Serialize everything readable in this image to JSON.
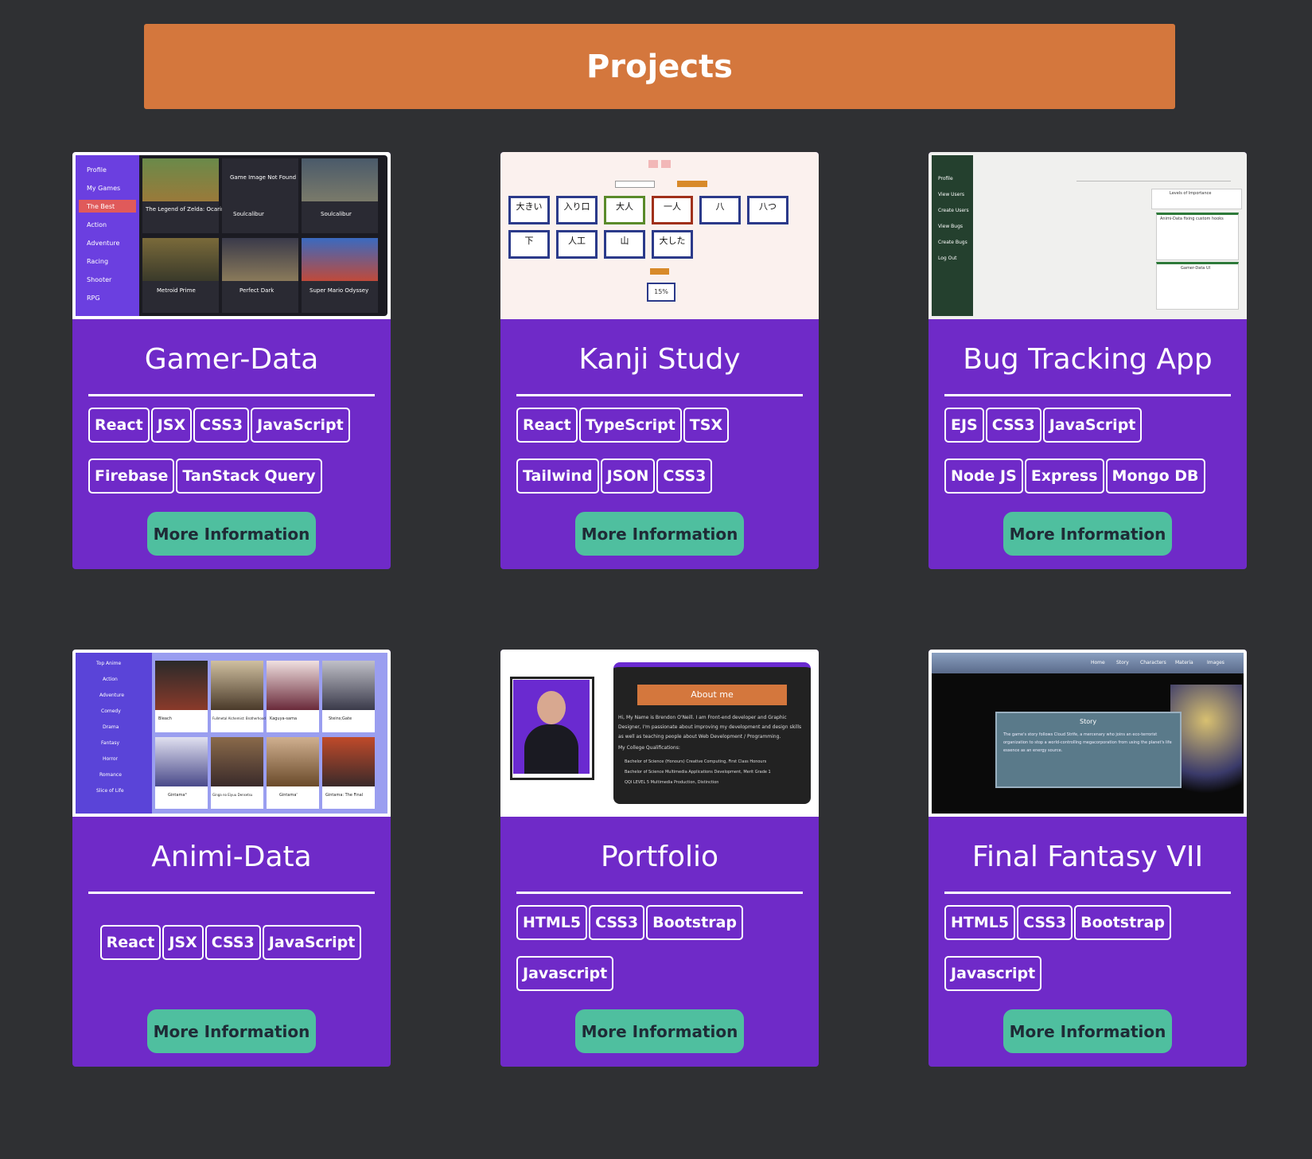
{
  "header": {
    "title": "Projects"
  },
  "projects": [
    {
      "title": "Gamer-Data",
      "tags": [
        "React",
        "JSX",
        "CSS3",
        "JavaScript",
        "Firebase",
        "TanStack Query"
      ],
      "button": "More Information",
      "thumb": {
        "menu": [
          "Profile",
          "My Games",
          "The Best",
          "Action",
          "Adventure",
          "Racing",
          "Shooter",
          "RPG"
        ],
        "games": [
          "The Legend of Zelda: Ocarina of Time",
          "Soulcalibur",
          "Soulcalibur",
          "Metroid Prime",
          "Perfect Dark",
          "Super Mario Odyssey"
        ],
        "not_found": "Game Image Not Found"
      }
    },
    {
      "title": "Kanji Study",
      "tags": [
        "React",
        "TypeScript",
        "TSX",
        "Tailwind",
        "JSON",
        "CSS3"
      ],
      "button": "More Information",
      "thumb": {
        "kanji_row1": [
          "大きい",
          "入り口",
          "大人",
          "一人",
          "八",
          "八つ"
        ],
        "kanji_row2": [
          "下",
          "人工",
          "山",
          "大した"
        ],
        "score": "15%"
      }
    },
    {
      "title": "Bug Tracking App",
      "tags": [
        "EJS",
        "CSS3",
        "JavaScript",
        "Node JS",
        "Express",
        "Mongo DB"
      ],
      "button": "More Information",
      "thumb": {
        "menu": [
          "Profile",
          "View Users",
          "Create Users",
          "View Bugs",
          "Create Bugs",
          "Log Out"
        ],
        "legend": "Levels of Importance",
        "bug1": "Animi-Data fixing custom hooks",
        "bug2": "Gamer-Data UI"
      }
    },
    {
      "title": "Animi-Data",
      "tags": [
        "React",
        "JSX",
        "CSS3",
        "JavaScript"
      ],
      "button": "More Information",
      "thumb": {
        "menu": [
          "Top Anime",
          "Action",
          "Adventure",
          "Comedy",
          "Drama",
          "Fantasy",
          "Horror",
          "Romance",
          "Slice of Life"
        ],
        "titles": [
          "Bleach",
          "Fullmetal Alchemist: Brotherhood",
          "Kaguya-sama",
          "Steins;Gate",
          "Gintama°",
          "Ginga no Eiyuu Densetsu",
          "Gintama'",
          "Gintama: The Final"
        ]
      }
    },
    {
      "title": "Portfolio",
      "tags": [
        "HTML5",
        "CSS3",
        "Bootstrap",
        "Javascript"
      ],
      "button": "More Information",
      "thumb": {
        "about": "About me",
        "intro": "Hi, My Name is Brendon O'Neill. I am Front-end developer and Graphic Designer, I'm passionate about improving my development and design skills as well as teaching people about Web Development / Programming.",
        "quals_title": "My College Qualifications:",
        "quals": [
          "Bachelor of Science (Honours) Creative Computing, First Class Honours",
          "Bachelor of Science Multimedia Applications Development, Merit Grade 1",
          "QQI LEVEL 5 Multimedia Production, Distinction"
        ]
      }
    },
    {
      "title": "Final Fantasy VII",
      "tags": [
        "HTML5",
        "CSS3",
        "Bootstrap",
        "Javascript"
      ],
      "button": "More Information",
      "thumb": {
        "nav": [
          "Home",
          "Story",
          "Characters",
          "Materia",
          "Images"
        ],
        "story_title": "Story",
        "story": "The game's story follows Cloud Strife, a mercenary who joins an eco-terrorist organization to stop a world-controlling megacorporation from using the planet's life essence as an energy source."
      }
    }
  ]
}
